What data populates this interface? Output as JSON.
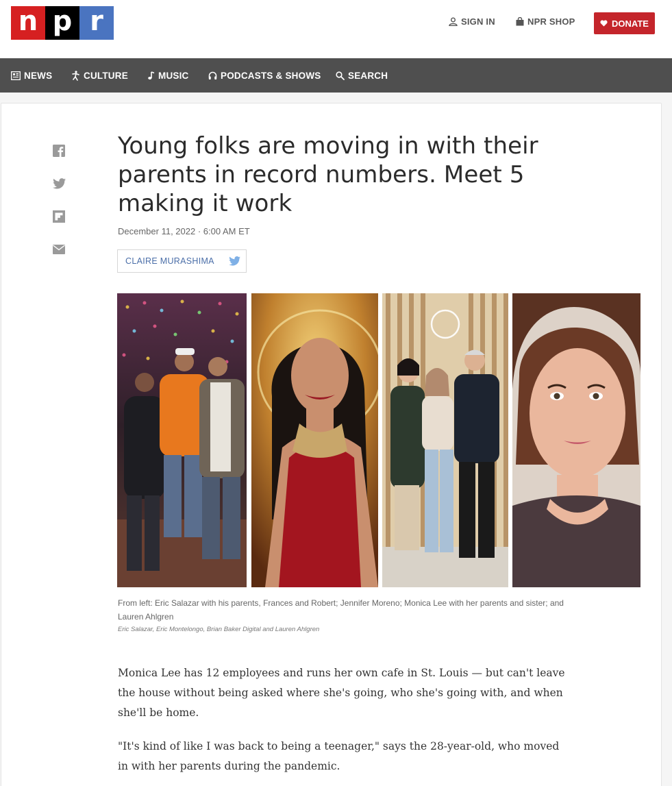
{
  "header": {
    "logo_letters": [
      "n",
      "p",
      "r"
    ],
    "sign_in": "SIGN IN",
    "shop": "NPR SHOP",
    "donate": "DONATE"
  },
  "nav": {
    "items": [
      {
        "label": "NEWS",
        "icon": "news-icon"
      },
      {
        "label": "CULTURE",
        "icon": "culture-icon"
      },
      {
        "label": "MUSIC",
        "icon": "music-note-icon"
      },
      {
        "label": "PODCASTS & SHOWS",
        "icon": "headphones-icon"
      },
      {
        "label": "SEARCH",
        "icon": "search-icon"
      }
    ]
  },
  "share": [
    "facebook-icon",
    "twitter-icon",
    "flipboard-icon",
    "email-icon"
  ],
  "article": {
    "title": "Young folks are moving in with their parents in record numbers. Meet 5 making it work",
    "date": "December 11, 2022 · 6:00 AM ET",
    "author": "CLAIRE MURASHIMA",
    "caption": "From left: Eric Salazar with his parents, Frances and Robert; Jennifer Moreno; Monica Lee with her parents and sister; and Lauren Ahlgren",
    "credit": "Eric Salazar, Eric Montelongo, Brian Baker Digital and Lauren Ahlgren",
    "paragraphs": [
      "Monica Lee has 12 employees and runs her own cafe in St. Louis — but can't leave the house without being asked where she's going, who she's going with, and when she'll be home.",
      "\"It's kind of like I was back to being a teenager,\" says the 28-year-old, who moved in with her parents during the pandemic."
    ]
  },
  "colors": {
    "brand_red": "#d62021",
    "brand_blue": "#4a74c0",
    "donate_red": "#c4252b",
    "nav_bg": "#4f4f4f",
    "author_link": "#4a6ea8"
  }
}
